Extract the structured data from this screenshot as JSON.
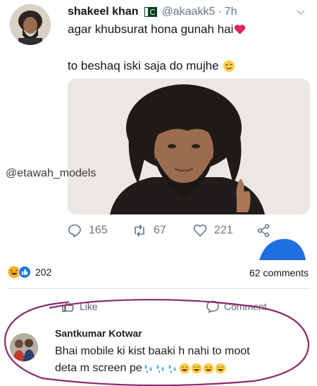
{
  "tweet": {
    "name": "shakeel khan",
    "flag_icon": "pakistan-flag-icon",
    "handle": "@akaakk5",
    "separator": "·",
    "time": "7h",
    "line1": "agar khubsurat hona gunah hai",
    "line2": "to beshaq iski saja do mujhe",
    "watermark": "@etawah_models",
    "actions": {
      "reply_count": "165",
      "retweet_count": "67",
      "like_count": "221"
    }
  },
  "facebook": {
    "reaction_count": "202",
    "comments_count": "62 comments",
    "like_label": "Like",
    "comment_label": "Comment",
    "comment": {
      "author": "Santkumar Kotwar",
      "line1": "Bhai mobile ki kist baaki h nahi to moot",
      "line2": "deta m screen pe"
    }
  },
  "colors": {
    "twitter_grey": "#657786",
    "facebook_blue": "#1877f2",
    "circle_mark": "#8b2a6e"
  }
}
